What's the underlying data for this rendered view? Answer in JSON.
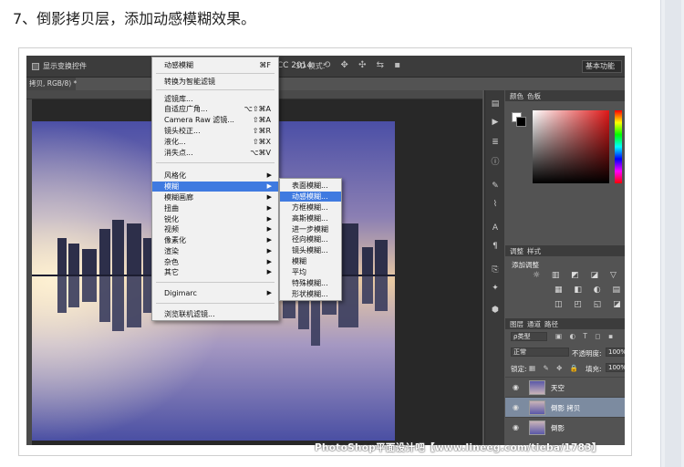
{
  "step_title": "7、倒影拷贝层，添加动感模糊效果。",
  "app": {
    "title": "hop CC 2014",
    "show_transform_label": "显示变换控件",
    "mode_3d_label": "3D 模式:",
    "workspace": "基本功能",
    "doc_tab": "拷贝, RGB/8) *"
  },
  "filter_menu": {
    "items": [
      {
        "label": "动感模糊",
        "shortcut": "⌘F"
      },
      {
        "label": "转换为智能滤镜"
      },
      {
        "label": "滤镜库..."
      },
      {
        "label": "自适应广角...",
        "shortcut": "⌥⇧⌘A"
      },
      {
        "label": "Camera Raw 滤镜...",
        "shortcut": "⇧⌘A"
      },
      {
        "label": "镜头校正...",
        "shortcut": "⇧⌘R"
      },
      {
        "label": "液化...",
        "shortcut": "⇧⌘X"
      },
      {
        "label": "消失点...",
        "shortcut": "⌥⌘V"
      },
      {
        "label": "风格化",
        "submenu": true
      },
      {
        "label": "模糊",
        "submenu": true,
        "highlighted": true
      },
      {
        "label": "模糊画廊",
        "submenu": true
      },
      {
        "label": "扭曲",
        "submenu": true
      },
      {
        "label": "锐化",
        "submenu": true
      },
      {
        "label": "视频",
        "submenu": true
      },
      {
        "label": "像素化",
        "submenu": true
      },
      {
        "label": "渲染",
        "submenu": true
      },
      {
        "label": "杂色",
        "submenu": true
      },
      {
        "label": "其它",
        "submenu": true
      },
      {
        "label": "Digimarc",
        "submenu": true
      },
      {
        "label": "浏览联机滤镜..."
      }
    ]
  },
  "blur_submenu": {
    "items": [
      {
        "label": "表面模糊..."
      },
      {
        "label": "动感模糊...",
        "highlighted": true
      },
      {
        "label": "方框模糊..."
      },
      {
        "label": "高斯模糊..."
      },
      {
        "label": "进一步模糊"
      },
      {
        "label": "径向模糊..."
      },
      {
        "label": "镜头模糊..."
      },
      {
        "label": "模糊"
      },
      {
        "label": "平均"
      },
      {
        "label": "特殊模糊..."
      },
      {
        "label": "形状模糊..."
      }
    ]
  },
  "panels": {
    "color_tabs": [
      "颜色",
      "色板"
    ],
    "adjust_tabs": [
      "调整",
      "样式"
    ],
    "add_adjustment": "添加调整",
    "layer_tabs": [
      "图层",
      "通道",
      "路径"
    ],
    "kind_filter": "ρ类型",
    "blend_mode": "正常",
    "opacity_label": "不透明度:",
    "opacity_value": "100%",
    "lock_label": "锁定:",
    "fill_label": "填充:",
    "fill_value": "100%",
    "layers": [
      {
        "name": "天空",
        "selected": false
      },
      {
        "name": "倒影 拷贝",
        "selected": true
      },
      {
        "name": "倒影",
        "selected": false
      }
    ]
  },
  "watermark": "PhotoShop平面设计吧【www.lineeg.com/tieba/1783】",
  "colors": {
    "menu_highlight": "#3f7ae0",
    "ps_background": "#535353",
    "selected_layer": "#7c8ba0"
  }
}
